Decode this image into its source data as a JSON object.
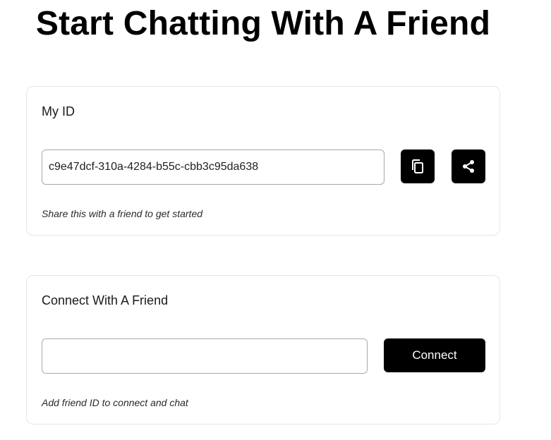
{
  "page": {
    "title": "Start Chatting With A Friend"
  },
  "my_id_card": {
    "heading": "My ID",
    "id_value": "c9e47dcf-310a-4284-b55c-cbb3c95da638",
    "copy_icon": "copy-icon",
    "share_icon": "share-icon",
    "hint": "Share this with a friend to get started"
  },
  "connect_card": {
    "heading": "Connect With A Friend",
    "friend_id_value": "",
    "connect_label": "Connect",
    "hint": "Add friend ID to connect and chat"
  },
  "colors": {
    "button_bg": "#000000",
    "button_fg": "#ffffff",
    "card_border": "#e6e6e6",
    "input_border": "#a9a9a9"
  }
}
